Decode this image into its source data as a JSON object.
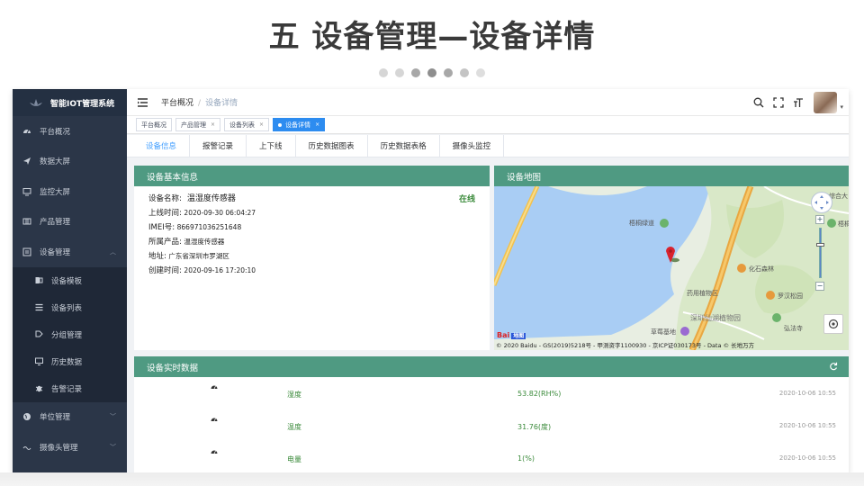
{
  "slide": {
    "title": "五 设备管理—设备详情",
    "dots": [
      {
        "color": "#d6d6d6"
      },
      {
        "color": "#d6d6d6"
      },
      {
        "color": "#a8a8a8"
      },
      {
        "color": "#8e8e8e"
      },
      {
        "color": "#a8a8a8"
      },
      {
        "color": "#c4c4c4"
      },
      {
        "color": "#dedede"
      }
    ]
  },
  "sidebar": {
    "brand": "智能IOT管理系统",
    "items": [
      {
        "label": "平台概况",
        "icon": "dashboard-icon"
      },
      {
        "label": "数据大屏",
        "icon": "send-icon"
      },
      {
        "label": "监控大屏",
        "icon": "monitor-icon"
      },
      {
        "label": "产品管理",
        "icon": "grid-icon"
      },
      {
        "label": "设备管理",
        "icon": "device-icon",
        "expanded": true
      }
    ],
    "sub_items": [
      {
        "label": "设备模板",
        "icon": "template-icon"
      },
      {
        "label": "设备列表",
        "icon": "list-icon"
      },
      {
        "label": "分组管理",
        "icon": "group-icon"
      },
      {
        "label": "历史数据",
        "icon": "history-icon"
      },
      {
        "label": "告警记录",
        "icon": "bug-icon"
      }
    ],
    "bottom_items": [
      {
        "label": "单位管理",
        "icon": "globe-icon"
      },
      {
        "label": "摄像头管理",
        "icon": "camera-icon"
      }
    ]
  },
  "header": {
    "breadcrumb_root": "平台概况",
    "breadcrumb_sep": "/",
    "breadcrumb_current": "设备详情"
  },
  "tags": [
    {
      "label": "平台概况",
      "closable": false,
      "active": false
    },
    {
      "label": "产品管理",
      "closable": true,
      "active": false
    },
    {
      "label": "设备列表",
      "closable": true,
      "active": false
    },
    {
      "label": "设备详情",
      "closable": true,
      "active": true
    }
  ],
  "tabs": [
    {
      "label": "设备信息",
      "active": true
    },
    {
      "label": "报警记录"
    },
    {
      "label": "上下线"
    },
    {
      "label": "历史数据图表"
    },
    {
      "label": "历史数据表格"
    },
    {
      "label": "摄像头监控"
    }
  ],
  "device_info": {
    "panel_title": "设备基本信息",
    "status": "在线",
    "name_label": "设备名称:",
    "name_value": "温湿度传感器",
    "online_label": "上线时间:",
    "online_value": "2020-09-30 06:04:27",
    "imei_label": "IMEI号:",
    "imei_value": "866971036251648",
    "product_label": "所属产品:",
    "product_value": "温湿度传感器",
    "address_label": "地址:",
    "address_value": "广东省深圳市罗湖区",
    "created_label": "创建时间:",
    "created_value": "2020-09-16 17:20:10"
  },
  "map": {
    "panel_title": "设备地图",
    "labels": [
      "综合大",
      "梧桐绿道",
      "梧桐",
      "化石森林",
      "罗汉松园",
      "药用植物区",
      "草莓基地",
      "深圳仙湖植物园",
      "弘法寺"
    ],
    "logo_text": "Bai",
    "logo_badge": "地图",
    "copyright": "© 2020 Baidu - GS(2019)5218号 - 甲测资字1100930 - 京ICP证030173号 - Data © 长地万方"
  },
  "realtime": {
    "panel_title": "设备实时数据",
    "rows": [
      {
        "name": "湿度",
        "value": "53.82(RH%)",
        "time": "2020-10-06 10:55"
      },
      {
        "name": "温度",
        "value": "31.76(度)",
        "time": "2020-10-06 10:55"
      },
      {
        "name": "电量",
        "value": "1(%)",
        "time": "2020-10-06 10:55"
      }
    ]
  },
  "colors": {
    "panel_header": "#4f9a82",
    "sidebar_bg": "#2b3648",
    "active_tag": "#2d8cf0",
    "active_tab": "#409eff",
    "value_green": "#3a8a3a"
  }
}
